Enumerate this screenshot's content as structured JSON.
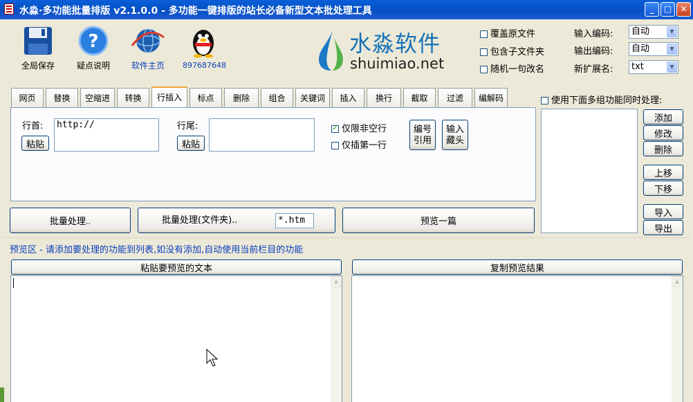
{
  "window": {
    "title": "水淼·多功能批量排版 v2.1.0.0 - 多功能一键排版的站长必备新型文本批处理工具",
    "minimize": "_",
    "maximize": "□",
    "close": "✕"
  },
  "toolbar": {
    "save": "全局保存",
    "help": "疑点说明",
    "home": "软件主页",
    "qq": "897687648"
  },
  "logo": {
    "cn": "水淼软件",
    "en": "shuimiao.net"
  },
  "options": {
    "overwrite": "覆盖原文件",
    "include_sub": "包含子文件夹",
    "random_rename": "随机一句改名",
    "input_enc_label": "输入编码:",
    "input_enc_value": "自动",
    "output_enc_label": "输出编码:",
    "output_enc_value": "自动",
    "ext_label": "新扩展名:",
    "ext_value": "txt"
  },
  "tabs": [
    "网页",
    "替换",
    "空缩进",
    "转换",
    "行插入",
    "标点",
    "删除",
    "组合",
    "关键词",
    "插入",
    "换行",
    "截取",
    "过滤",
    "编解码"
  ],
  "active_tab": 4,
  "panel": {
    "head_label": "行首:",
    "head_value": "http://",
    "paste1": "粘贴",
    "tail_label": "行尾:",
    "tail_value": "",
    "paste2": "粘贴",
    "nonempty": "仅限非空行",
    "firstline": "仅插第一行",
    "number_btn1": "编号",
    "number_btn2": "引用",
    "input_btn1": "输入",
    "input_btn2": "藏头"
  },
  "actions": {
    "batch": "批量处理..",
    "batch_folder": "批量处理(文件夹)..",
    "pattern": "*.htm",
    "preview": "预览一篇"
  },
  "multi": {
    "label": "使用下面多组功能同时处理:",
    "add": "添加",
    "edit": "修改",
    "delete": "删除",
    "up": "上移",
    "down": "下移",
    "import": "导入",
    "export": "导出"
  },
  "preview": {
    "hint": "预览区 - 请添加要处理的功能到列表,如没有添加,自动使用当前栏目的功能",
    "paste_btn": "粘贴要预览的文本",
    "copy_btn": "复制预览结果",
    "input_text": "",
    "output_text": ""
  },
  "colors": {
    "title_bar": "#0a5fd8",
    "hint": "#0b3ebd",
    "logo": "#1673b8",
    "accent_tab": "#f3a734"
  },
  "icons": [
    "floppy-disk-icon",
    "help-icon",
    "globe-icon",
    "qq-penguin-icon",
    "water-drop-logo-icon"
  ]
}
